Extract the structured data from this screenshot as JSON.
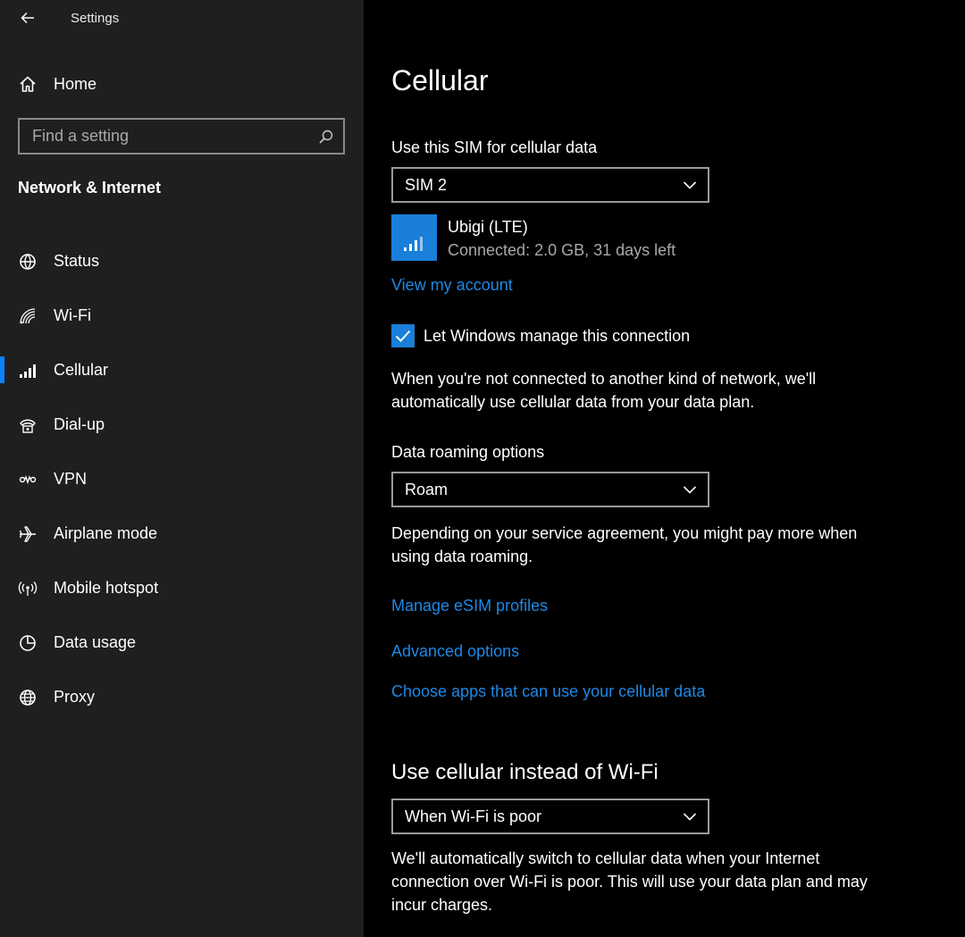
{
  "window": {
    "title": "Settings"
  },
  "sidebar": {
    "home_label": "Home",
    "search_placeholder": "Find a setting",
    "section_title": "Network & Internet",
    "items": [
      {
        "label": "Status",
        "icon": "globe-status-icon"
      },
      {
        "label": "Wi-Fi",
        "icon": "wifi-icon"
      },
      {
        "label": "Cellular",
        "icon": "cellular-signal-icon",
        "selected": true
      },
      {
        "label": "Dial-up",
        "icon": "dialup-icon"
      },
      {
        "label": "VPN",
        "icon": "vpn-icon"
      },
      {
        "label": "Airplane mode",
        "icon": "airplane-icon"
      },
      {
        "label": "Mobile hotspot",
        "icon": "hotspot-icon"
      },
      {
        "label": "Data usage",
        "icon": "pie-chart-icon"
      },
      {
        "label": "Proxy",
        "icon": "globe-icon"
      }
    ]
  },
  "main": {
    "title": "Cellular",
    "sim_label": "Use this SIM for cellular data",
    "sim_selected": "SIM 2",
    "carrier_name": "Ubigi (LTE)",
    "carrier_status": "Connected: 2.0 GB, 31 days left",
    "view_account": "View my account",
    "manage_checkbox_label": "Let Windows manage this connection",
    "manage_checked": true,
    "manage_desc_line1": "When you're not connected to another kind of network, we'll",
    "manage_desc_line2": "automatically use cellular data from your data plan.",
    "roaming_label": "Data roaming options",
    "roaming_selected": "Roam",
    "roaming_desc_line1": "Depending on your service agreement, you might pay more when",
    "roaming_desc_line2": "using data roaming.",
    "link_esim": "Manage eSIM profiles",
    "link_advanced": "Advanced options",
    "link_apps": "Choose apps that can use your cellular data",
    "cellular_heading": "Use cellular instead of Wi-Fi",
    "cellular_selected": "When Wi-Fi is poor",
    "cellular_desc_line1": "We'll automatically switch to cellular data when your Internet",
    "cellular_desc_line2": "connection over Wi-Fi is poor. This will use your data plan and may",
    "cellular_desc_line3": "incur charges."
  },
  "colors": {
    "accent": "#1a7fd8",
    "link": "#1e88e5",
    "sidebar_bg": "#1f1f1f",
    "main_bg": "#000000"
  }
}
